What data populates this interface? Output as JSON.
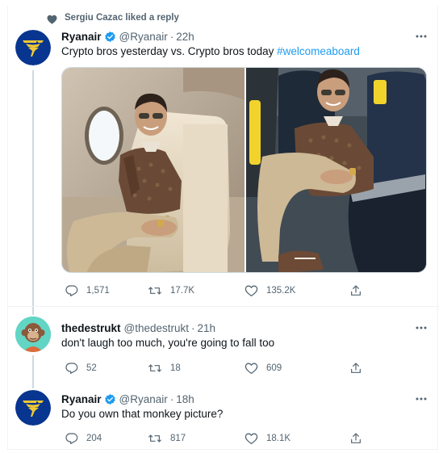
{
  "social_context": "Sergiu Cazac liked a reply",
  "tweets": [
    {
      "name": "Ryanair",
      "handle": "@Ryanair",
      "time": "22h",
      "text": "Crypto bros yesterday vs. Crypto bros today ",
      "hashtag": "#welcomeaboard",
      "replies": "1,571",
      "retweets": "17.7K",
      "likes": "135.2K"
    },
    {
      "name": "thedestrukt",
      "handle": "@thedestrukt",
      "time": "21h",
      "text": "don't laugh too much, you're going to fall too",
      "replies": "52",
      "retweets": "18",
      "likes": "609"
    },
    {
      "name": "Ryanair",
      "handle": "@Ryanair",
      "time": "18h",
      "text": "Do you own that monkey picture?",
      "replies": "204",
      "retweets": "817",
      "likes": "18.1K"
    }
  ],
  "separator": "·",
  "colors": {
    "accent": "#1d9bf0",
    "secondary_text": "#536471",
    "ryanair_navy": "#073590",
    "ryanair_gold": "#f1c933"
  },
  "icons": [
    "heart-icon",
    "verified-badge-icon",
    "more-icon",
    "reply-icon",
    "retweet-icon",
    "like-icon",
    "share-icon"
  ]
}
